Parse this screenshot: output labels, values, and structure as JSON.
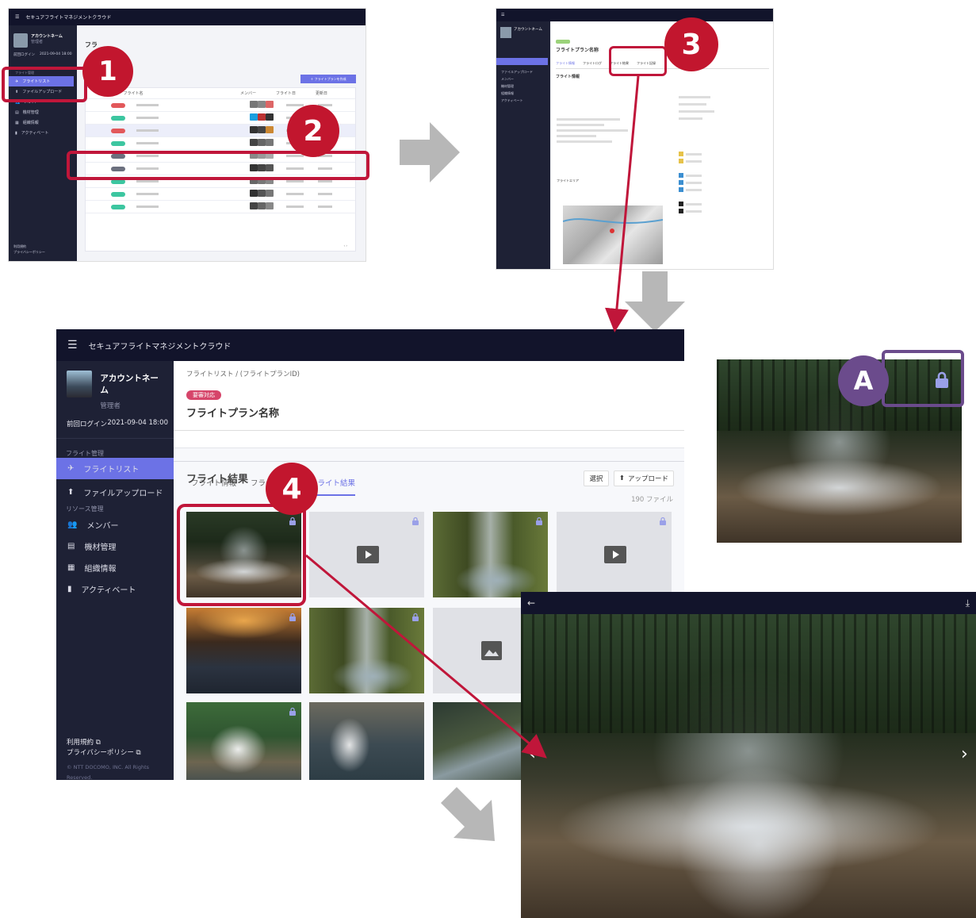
{
  "app": {
    "title": "セキュアフライトマネジメントクラウド",
    "account_name": "アカウントネーム",
    "role": "管理者",
    "last_login_label": "前回ログイン",
    "last_login_value": "2021-09-04 18:00"
  },
  "sidebar": {
    "section_flight": "フライト管理",
    "flight_list": "フライトリスト",
    "file_upload": "ファイルアップロード",
    "section_resource": "リソース管理",
    "members": "メンバー",
    "equipment": "機材管理",
    "organization": "組織情報",
    "activate": "アクティベート",
    "terms": "利用規約",
    "privacy": "プライバシーポリシー",
    "copyright": "© NTT DOCOMO, INC. All Rights Reserved."
  },
  "main": {
    "breadcrumb": "フライトリスト / (フライトプランID)",
    "status_badge": "要審対応",
    "plan_title": "フライトプラン名称",
    "tabs": [
      "フライト情報",
      "フライトログ",
      "フライト結果"
    ],
    "section_title": "フライト結果",
    "select_btn": "選択",
    "upload_btn": "アップロード",
    "file_count": "190 ファイル"
  },
  "screen1": {
    "page_title": "フラ",
    "new_btn": "＋ フライトプランを作成",
    "col_name": "フライト名",
    "col_member": "メンバー",
    "col_date": "フライト日",
    "col_updated": "更新日"
  },
  "screen2": {
    "tabs": [
      "フライト情報",
      "フライトログ",
      "フライト結果",
      "フライト記録"
    ],
    "section": "フライト情報",
    "area_label": "フライトエリア"
  },
  "callouts": {
    "step1": "1",
    "step2": "2",
    "step3": "3",
    "step4": "4",
    "stepA": "A"
  }
}
